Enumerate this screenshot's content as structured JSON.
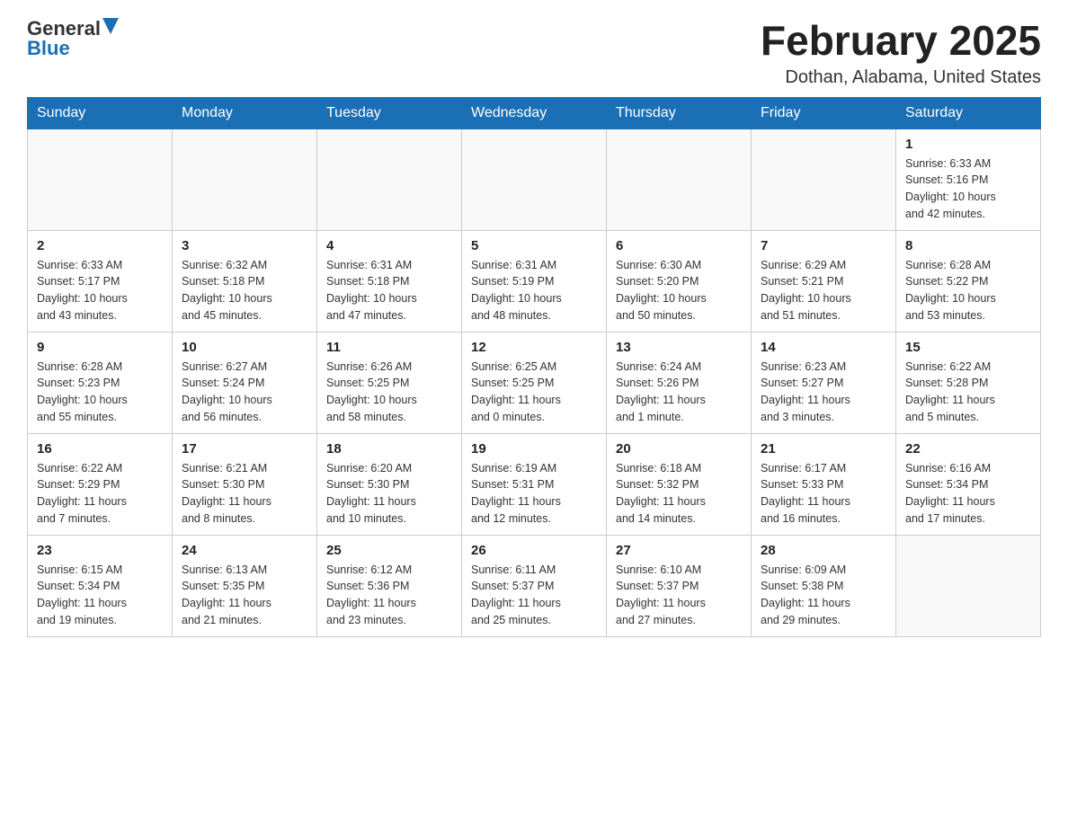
{
  "logo": {
    "general": "General",
    "blue": "Blue"
  },
  "title": "February 2025",
  "location": "Dothan, Alabama, United States",
  "weekdays": [
    "Sunday",
    "Monday",
    "Tuesday",
    "Wednesday",
    "Thursday",
    "Friday",
    "Saturday"
  ],
  "weeks": [
    [
      {
        "day": "",
        "info": ""
      },
      {
        "day": "",
        "info": ""
      },
      {
        "day": "",
        "info": ""
      },
      {
        "day": "",
        "info": ""
      },
      {
        "day": "",
        "info": ""
      },
      {
        "day": "",
        "info": ""
      },
      {
        "day": "1",
        "info": "Sunrise: 6:33 AM\nSunset: 5:16 PM\nDaylight: 10 hours\nand 42 minutes."
      }
    ],
    [
      {
        "day": "2",
        "info": "Sunrise: 6:33 AM\nSunset: 5:17 PM\nDaylight: 10 hours\nand 43 minutes."
      },
      {
        "day": "3",
        "info": "Sunrise: 6:32 AM\nSunset: 5:18 PM\nDaylight: 10 hours\nand 45 minutes."
      },
      {
        "day": "4",
        "info": "Sunrise: 6:31 AM\nSunset: 5:18 PM\nDaylight: 10 hours\nand 47 minutes."
      },
      {
        "day": "5",
        "info": "Sunrise: 6:31 AM\nSunset: 5:19 PM\nDaylight: 10 hours\nand 48 minutes."
      },
      {
        "day": "6",
        "info": "Sunrise: 6:30 AM\nSunset: 5:20 PM\nDaylight: 10 hours\nand 50 minutes."
      },
      {
        "day": "7",
        "info": "Sunrise: 6:29 AM\nSunset: 5:21 PM\nDaylight: 10 hours\nand 51 minutes."
      },
      {
        "day": "8",
        "info": "Sunrise: 6:28 AM\nSunset: 5:22 PM\nDaylight: 10 hours\nand 53 minutes."
      }
    ],
    [
      {
        "day": "9",
        "info": "Sunrise: 6:28 AM\nSunset: 5:23 PM\nDaylight: 10 hours\nand 55 minutes."
      },
      {
        "day": "10",
        "info": "Sunrise: 6:27 AM\nSunset: 5:24 PM\nDaylight: 10 hours\nand 56 minutes."
      },
      {
        "day": "11",
        "info": "Sunrise: 6:26 AM\nSunset: 5:25 PM\nDaylight: 10 hours\nand 58 minutes."
      },
      {
        "day": "12",
        "info": "Sunrise: 6:25 AM\nSunset: 5:25 PM\nDaylight: 11 hours\nand 0 minutes."
      },
      {
        "day": "13",
        "info": "Sunrise: 6:24 AM\nSunset: 5:26 PM\nDaylight: 11 hours\nand 1 minute."
      },
      {
        "day": "14",
        "info": "Sunrise: 6:23 AM\nSunset: 5:27 PM\nDaylight: 11 hours\nand 3 minutes."
      },
      {
        "day": "15",
        "info": "Sunrise: 6:22 AM\nSunset: 5:28 PM\nDaylight: 11 hours\nand 5 minutes."
      }
    ],
    [
      {
        "day": "16",
        "info": "Sunrise: 6:22 AM\nSunset: 5:29 PM\nDaylight: 11 hours\nand 7 minutes."
      },
      {
        "day": "17",
        "info": "Sunrise: 6:21 AM\nSunset: 5:30 PM\nDaylight: 11 hours\nand 8 minutes."
      },
      {
        "day": "18",
        "info": "Sunrise: 6:20 AM\nSunset: 5:30 PM\nDaylight: 11 hours\nand 10 minutes."
      },
      {
        "day": "19",
        "info": "Sunrise: 6:19 AM\nSunset: 5:31 PM\nDaylight: 11 hours\nand 12 minutes."
      },
      {
        "day": "20",
        "info": "Sunrise: 6:18 AM\nSunset: 5:32 PM\nDaylight: 11 hours\nand 14 minutes."
      },
      {
        "day": "21",
        "info": "Sunrise: 6:17 AM\nSunset: 5:33 PM\nDaylight: 11 hours\nand 16 minutes."
      },
      {
        "day": "22",
        "info": "Sunrise: 6:16 AM\nSunset: 5:34 PM\nDaylight: 11 hours\nand 17 minutes."
      }
    ],
    [
      {
        "day": "23",
        "info": "Sunrise: 6:15 AM\nSunset: 5:34 PM\nDaylight: 11 hours\nand 19 minutes."
      },
      {
        "day": "24",
        "info": "Sunrise: 6:13 AM\nSunset: 5:35 PM\nDaylight: 11 hours\nand 21 minutes."
      },
      {
        "day": "25",
        "info": "Sunrise: 6:12 AM\nSunset: 5:36 PM\nDaylight: 11 hours\nand 23 minutes."
      },
      {
        "day": "26",
        "info": "Sunrise: 6:11 AM\nSunset: 5:37 PM\nDaylight: 11 hours\nand 25 minutes."
      },
      {
        "day": "27",
        "info": "Sunrise: 6:10 AM\nSunset: 5:37 PM\nDaylight: 11 hours\nand 27 minutes."
      },
      {
        "day": "28",
        "info": "Sunrise: 6:09 AM\nSunset: 5:38 PM\nDaylight: 11 hours\nand 29 minutes."
      },
      {
        "day": "",
        "info": ""
      }
    ]
  ]
}
